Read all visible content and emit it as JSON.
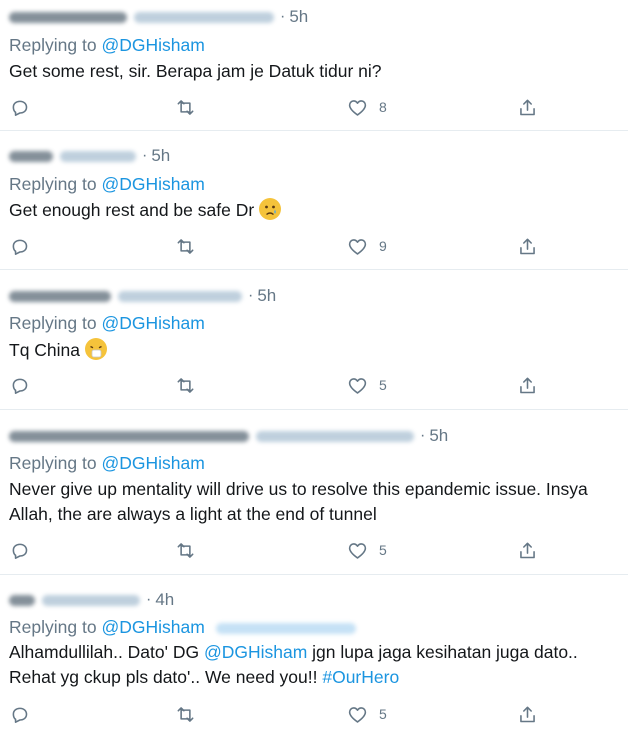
{
  "reply_prefix": "Replying to",
  "tweets": [
    {
      "time": "5h",
      "mention": "@DGHisham",
      "text": "Get some rest, sir. Berapa jam je Datuk tidur ni?",
      "likes": "8"
    },
    {
      "time": "5h",
      "mention": "@DGHisham",
      "text": "Get enough rest and be safe Dr",
      "emoji": "crying-face-emoji",
      "likes": "9"
    },
    {
      "time": "5h",
      "mention": "@DGHisham",
      "text": "Tq China",
      "emoji": "sneezing-face-emoji",
      "likes": "5"
    },
    {
      "time": "5h",
      "mention": "@DGHisham",
      "text": "Never give up mentality will drive us to resolve this epandemic issue. Insya Allah, the are always a light at the end of tunnel",
      "likes": "5"
    },
    {
      "time": "4h",
      "mention": "@DGHisham",
      "text_part1": "Alhamdullilah.. Dato' DG ",
      "text_mention": "@DGHisham",
      "text_part2": " jgn lupa jaga kesihatan juga dato.. Rehat yg ckup pls dato'.. We need you!! ",
      "hashtag": "#OurHero",
      "likes": "5"
    }
  ],
  "colors": {
    "accent": "#1b95e0",
    "muted": "#657786",
    "text": "#14171a",
    "divider": "#e6ecf0"
  },
  "icons": [
    "reply-icon",
    "retweet-icon",
    "like-icon",
    "share-icon"
  ]
}
